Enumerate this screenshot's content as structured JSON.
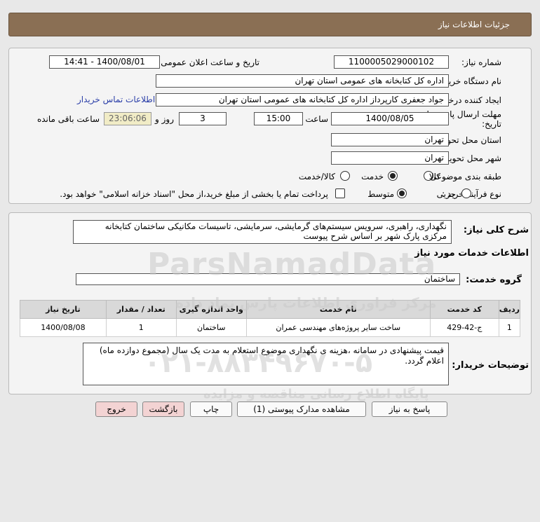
{
  "header": {
    "title": "جزئیات اطلاعات نیاز"
  },
  "form": {
    "need_number_label": "شماره نیاز:",
    "need_number": "1100005029000102",
    "announce_label": "تاریخ و ساعت اعلان عمومی:",
    "announce_value": "1400/08/01 - 14:41",
    "buyer_org_label": "نام دستگاه خریدار:",
    "buyer_org": "اداره کل کتابخانه های عمومی استان تهران",
    "creator_label": "ایجاد کننده درخواست:",
    "creator": "جواد جعفری کارپرداز اداره کل کتابخانه های عمومی استان تهران",
    "contact_link": "اطلاعات تماس خریدار",
    "deadline_label": "مهلت ارسال پاسخ: تا تاریخ:",
    "deadline_date": "1400/08/05",
    "time_label": "ساعت",
    "deadline_time": "15:00",
    "days": "3",
    "days_label": "روز و",
    "remaining": "23:06:06",
    "remaining_label": "ساعت باقی مانده",
    "province_label": "استان محل تحویل:",
    "province": "تهران",
    "city_label": "شهر محل تحویل:",
    "city": "تهران",
    "category_label": "طبقه بندی موضوعی:",
    "category_options": [
      "کالا",
      "خدمت",
      "کالا/خدمت"
    ],
    "process_label": "نوع فرآیند خرید :",
    "process_options": [
      "جزیی",
      "متوسط"
    ],
    "payment_note": "پرداخت تمام یا بخشی از مبلغ خرید،از محل \"اسناد خزانه اسلامی\" خواهد بود."
  },
  "details": {
    "summary_label": "شرح کلی نیاز:",
    "summary_line1": "نگهداری، راهبری، سرویس سیستم‌های گرمایشی، سرمایشی، تاسیسات مکانیکی ساختمان کتابخانه",
    "summary_line2": "مرکزی پارک شهر بر اساس شرح پیوست",
    "services_title": "اطلاعات خدمات مورد نیاز",
    "group_label": "گروه خدمت:",
    "group_value": "ساختمان",
    "table": {
      "headers": [
        "ردیف",
        "کد خدمت",
        "نام خدمت",
        "واحد اندازه گیری",
        "تعداد / مقدار",
        "تاریخ نیاز"
      ],
      "rows": [
        [
          "1",
          "ج-42-429",
          "ساخت سایر پروژه‌های مهندسی عمران",
          "ساختمان",
          "1",
          "1400/08/08"
        ]
      ]
    },
    "buyer_notes_label": "توضیحات خریدار:",
    "buyer_notes_line1": "قیمت پیشنهادی در سامانه ،هزینه ی نگهداری موضوع استعلام به مدت یک سال (مجموع دوازده ماه)",
    "buyer_notes_line2": "اعلام گردد."
  },
  "buttons": {
    "reply": "پاسخ به نیاز",
    "attachments": "مشاهده مدارک پیوستی (1)",
    "print": "چاپ",
    "back": "بازگشت",
    "exit": "خروج"
  },
  "watermark": {
    "brand": "ParsNamadData",
    "phone": "۰۲۱-۸۸۳۴۹۶۷۰-۵",
    "sub": "مرکز فراوری اطلاعات پارس نماد داده",
    "sub2": "پایگاه اطلاع رسانی مناقصه و مزایده"
  }
}
